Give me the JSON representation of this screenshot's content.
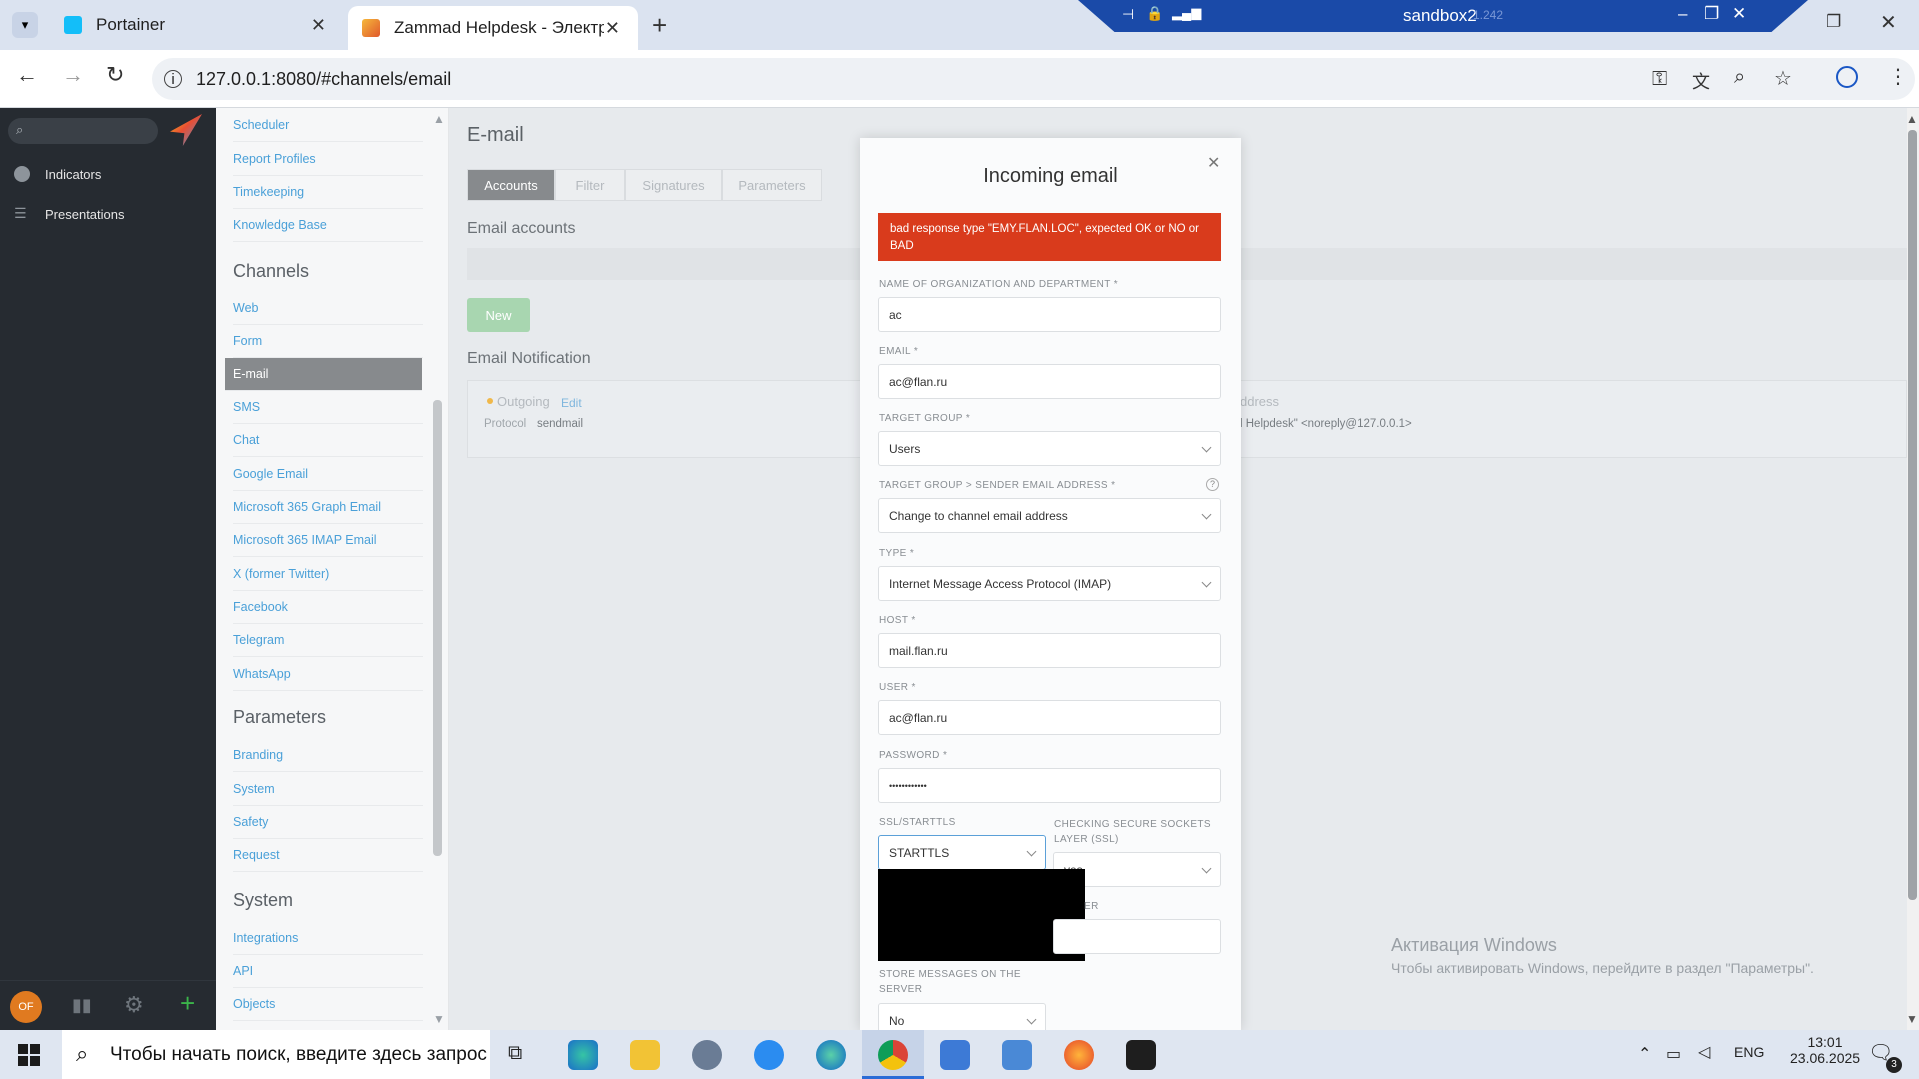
{
  "browser": {
    "tabs": [
      {
        "title": "Portainer"
      },
      {
        "title": "Zammad Helpdesk - Электронн"
      }
    ],
    "url": "127.0.0.1:8080/#channels/email",
    "remote_session": "sandbox2",
    "remote_suffix": "1.242"
  },
  "app": {
    "search_placeholder": "",
    "nav": [
      {
        "label": "Indicators"
      },
      {
        "label": "Presentations"
      }
    ],
    "avatar_initials": "OF"
  },
  "settings_menu": {
    "top_items": [
      "Scheduler",
      "Report Profiles",
      "Timekeeping",
      "Knowledge Base"
    ],
    "channels_heading": "Channels",
    "channels": [
      "Web",
      "Form",
      "E-mail",
      "SMS",
      "Chat",
      "Google Email",
      "Microsoft 365 Graph Email",
      "Microsoft 365 IMAP Email",
      "X (former Twitter)",
      "Facebook",
      "Telegram",
      "WhatsApp"
    ],
    "parameters_heading": "Parameters",
    "parameters": [
      "Branding",
      "System",
      "Safety",
      "Request"
    ],
    "system_heading": "System",
    "system": [
      "Integrations",
      "API",
      "Objects"
    ]
  },
  "page": {
    "title": "E-mail",
    "tabs": [
      "Accounts",
      "Filter",
      "Signatures",
      "Parameters"
    ],
    "email_accounts_heading": "Email accounts",
    "new_button": "New",
    "notification_heading": "Email Notification",
    "outgoing_label": "Outgoing",
    "edit_link": "Edit",
    "protocol_label": "Protocol",
    "protocol_value": "sendmail",
    "address_label": "ddress",
    "address_value": "l Helpdesk\" <noreply@127.0.0.1>"
  },
  "modal": {
    "title": "Incoming email",
    "error": "bad response type \"EMY.FLAN.LOC\", expected OK or NO or BAD",
    "fields": {
      "org_label": "NAME OF ORGANIZATION AND DEPARTMENT *",
      "org_value": "ac",
      "email_label": "EMAIL *",
      "email_value": "ac@flan.ru",
      "group_label": "TARGET GROUP *",
      "group_value": "Users",
      "sender_label": "TARGET GROUP > SENDER EMAIL ADDRESS *",
      "sender_value": "Change to channel email address",
      "type_label": "TYPE *",
      "type_value": "Internet Message Access Protocol (IMAP)",
      "host_label": "HOST *",
      "host_value": "mail.flan.ru",
      "user_label": "USER *",
      "user_value": "ac@flan.ru",
      "password_label": "PASSWORD *",
      "password_value": "••••••••••••",
      "ssl_label": "SSL/STARTTLS",
      "ssl_value": "STARTTLS",
      "check_ssl_label": "CHECKING SECURE SOCKETS LAYER (SSL)",
      "check_ssl_value": "yes",
      "folder_label_partial": "ER",
      "store_label": "STORE MESSAGES ON THE SERVER",
      "store_value": "No"
    }
  },
  "watermark": {
    "title": "Активация Windows",
    "text": "Чтобы активировать Windows, перейдите в раздел \"Параметры\"."
  },
  "taskbar": {
    "search_placeholder": "Чтобы начать поиск, введите здесь запрос",
    "language": "ENG",
    "time": "13:01",
    "date": "23.06.2025",
    "notifications_count": "3"
  }
}
